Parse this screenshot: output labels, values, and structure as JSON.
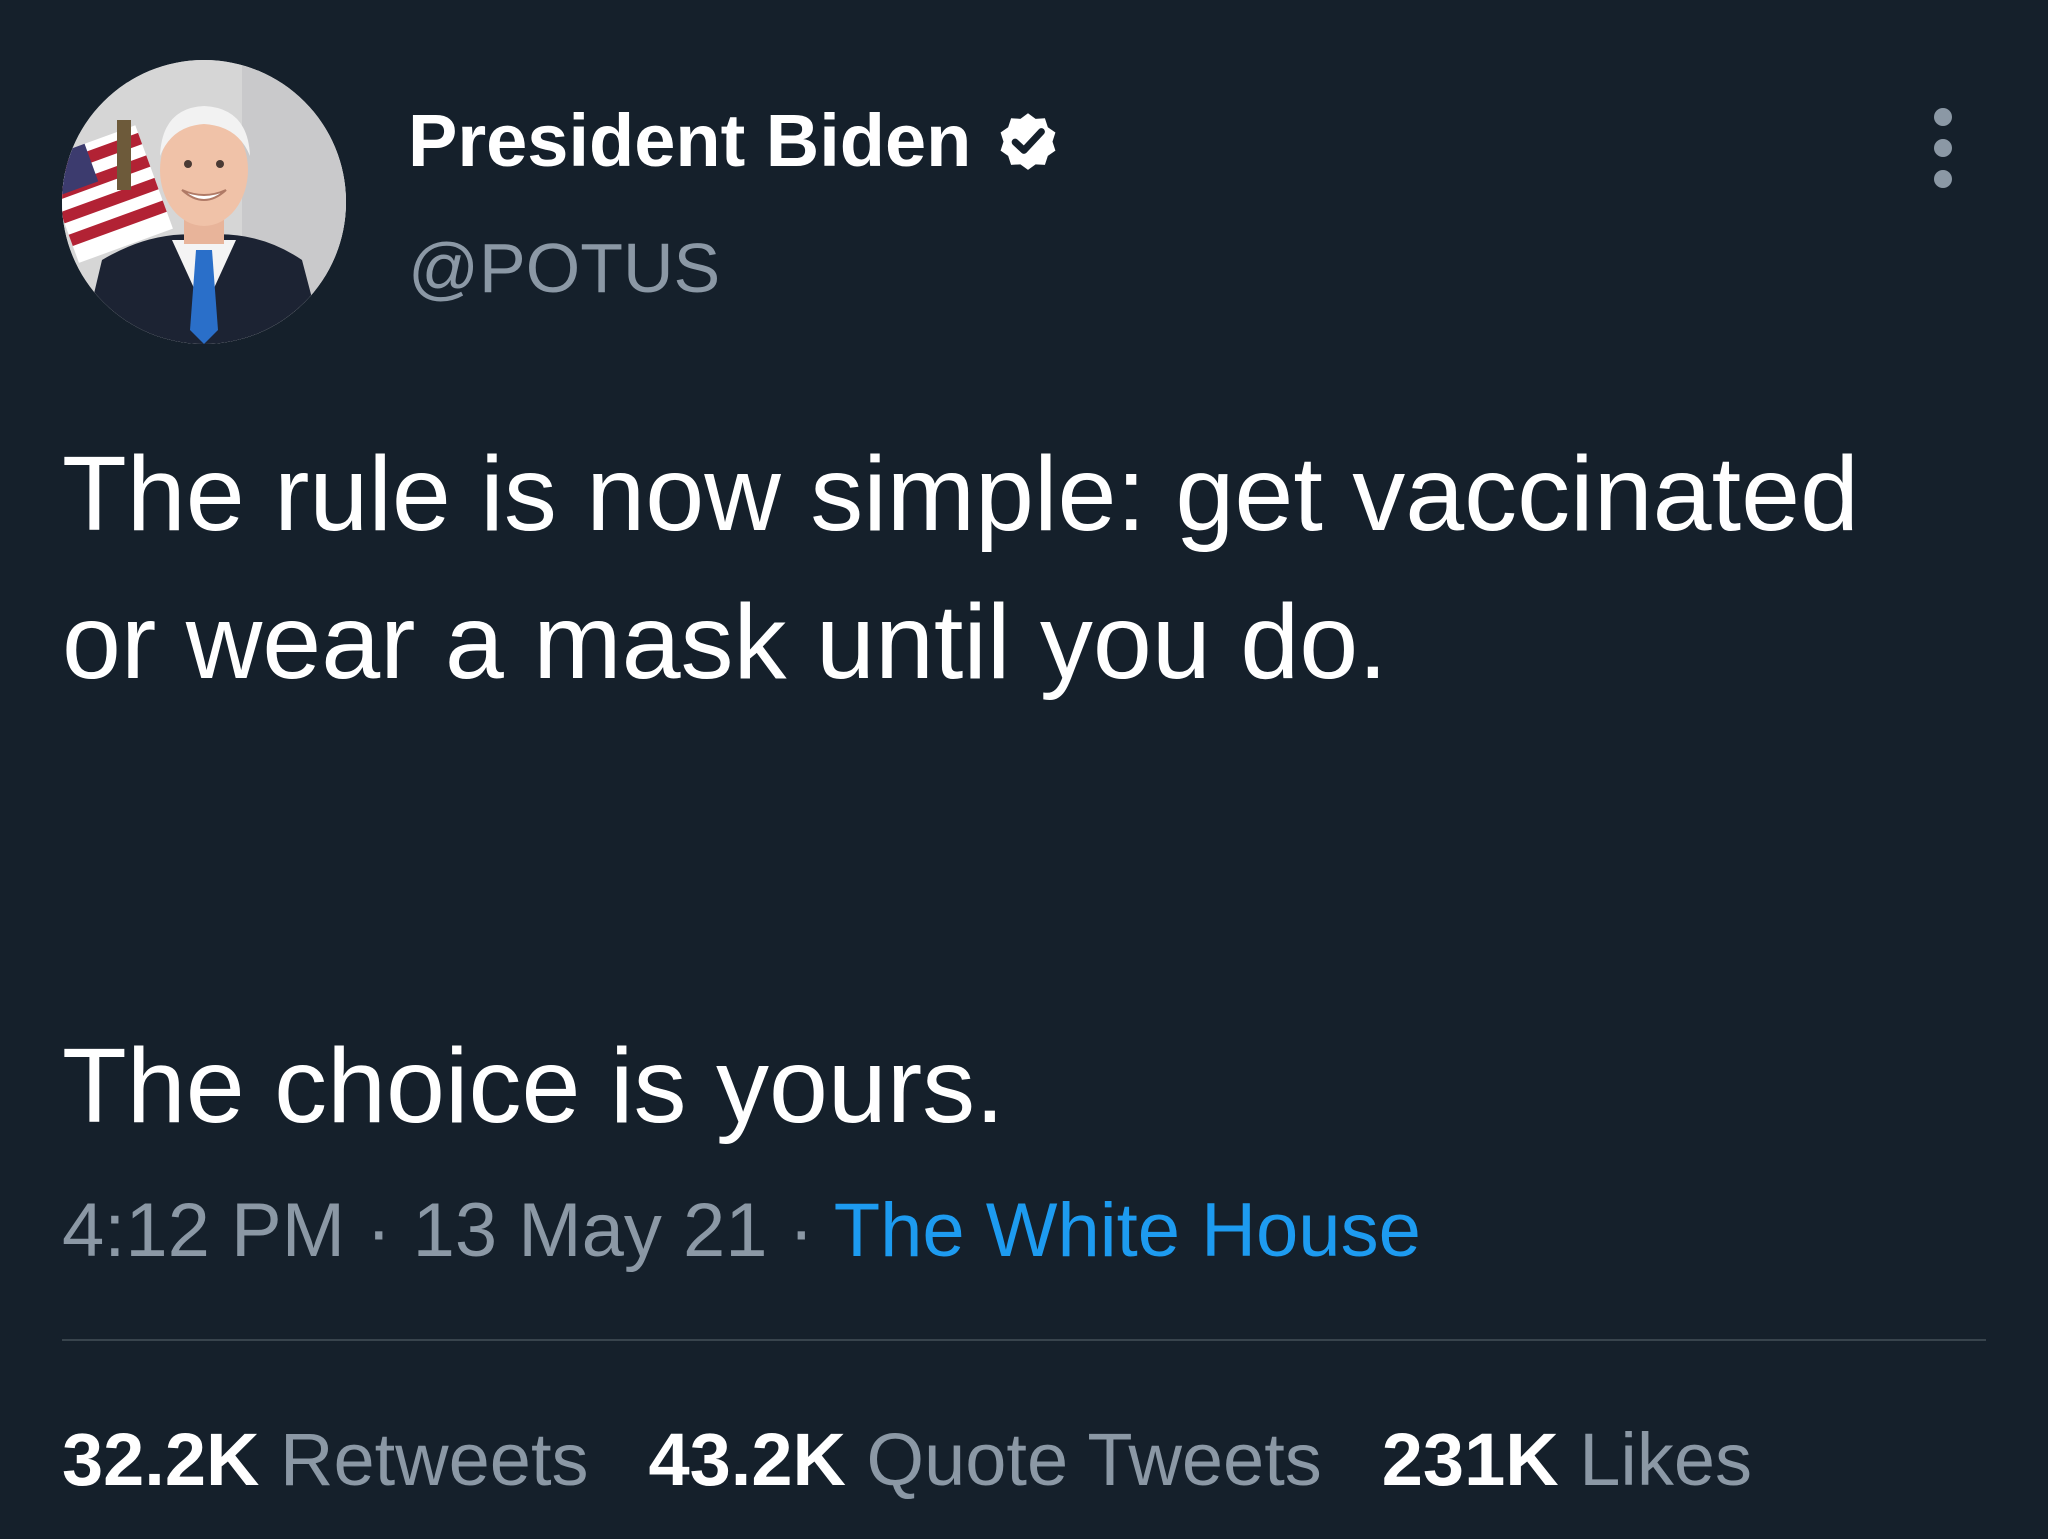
{
  "tweet": {
    "author": {
      "display_name": "President Biden",
      "handle": "@POTUS",
      "verified_icon": "verified-badge-icon",
      "avatar": "profile-photo"
    },
    "more_icon": "more-options-icon",
    "text_lines": [
      "The rule is now simple: get vaccinated or wear a mask until you do.",
      "The choice is yours."
    ],
    "time": "4:12 PM",
    "date": "13 May 21",
    "separator": "·",
    "source": "The White House",
    "stats": {
      "retweets_count": "32.2K",
      "retweets_label": "Retweets",
      "quote_tweets_count": "43.2K",
      "quote_tweets_label": "Quote Tweets",
      "likes_count": "231K",
      "likes_label": "Likes"
    }
  },
  "colors": {
    "background": "#15202b",
    "primary_text": "#ffffff",
    "secondary_text": "#8b98a5",
    "link": "#1d9bf0",
    "divider": "#38444d"
  }
}
